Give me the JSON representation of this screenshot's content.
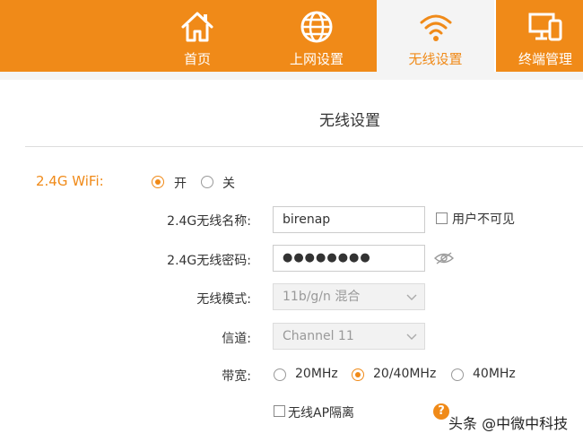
{
  "nav": {
    "tabs": [
      {
        "label": "首页",
        "icon": "home-icon",
        "active": false
      },
      {
        "label": "上网设置",
        "icon": "globe-icon",
        "active": false
      },
      {
        "label": "无线设置",
        "icon": "wifi-icon",
        "active": true
      },
      {
        "label": "终端管理",
        "icon": "devices-icon",
        "active": false
      }
    ],
    "accent_color": "#f08a18"
  },
  "page": {
    "title": "无线设置"
  },
  "wifi": {
    "label": "2.4G WiFi:",
    "on_label": "开",
    "off_label": "关",
    "enabled": true
  },
  "form": {
    "ssid_label": "2.4G无线名称:",
    "ssid_value": "birenap",
    "hide_ssid_label": "用户不可见",
    "password_label": "2.4G无线密码:",
    "password_value": "●●●●●●●●",
    "mode_label": "无线模式:",
    "mode_value": "11b/g/n 混合",
    "channel_label": "信道:",
    "channel_value": "Channel 11",
    "bandwidth_label": "带宽:",
    "bandwidth_options": [
      "20MHz",
      "20/40MHz",
      "40MHz"
    ],
    "bandwidth_selected": "20/40MHz",
    "ap_isolation_label": "无线AP隔离"
  },
  "help_glyph": "?",
  "watermark": "头条 @中微中科技"
}
